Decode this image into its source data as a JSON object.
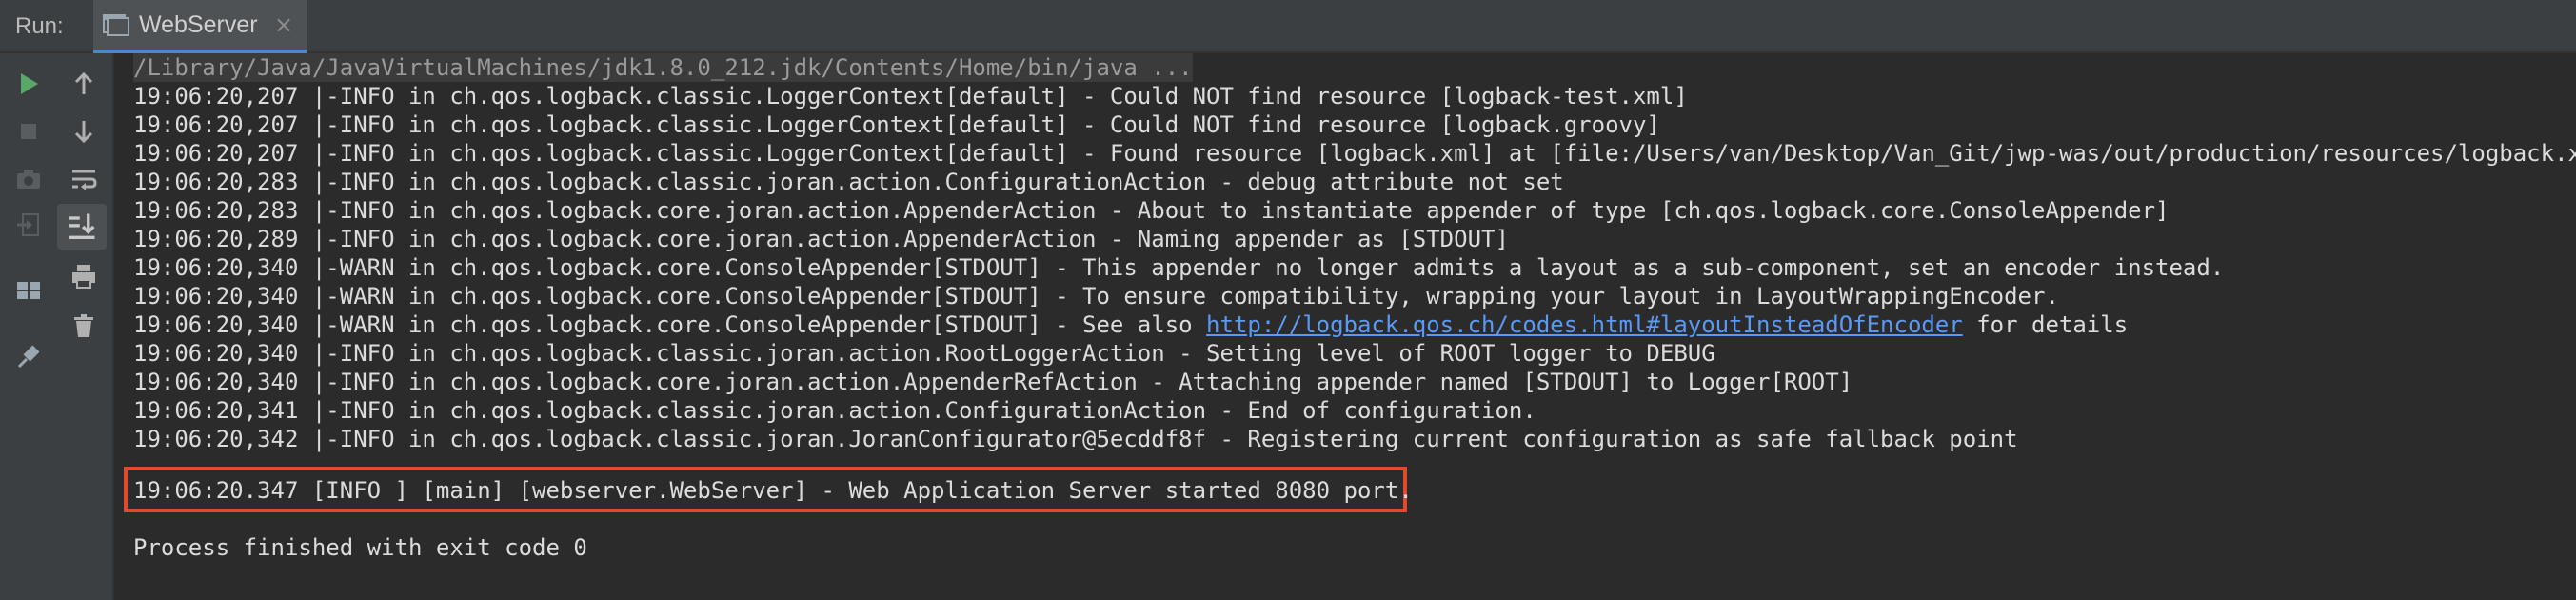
{
  "run_panel": {
    "label": "Run:",
    "tab": {
      "title": "WebServer",
      "close": "×"
    }
  },
  "toolbar": {
    "buttons": [
      {
        "name": "rerun-icon",
        "color": "#59a869"
      },
      {
        "name": "stop-icon"
      },
      {
        "name": "camera-icon"
      },
      {
        "name": "import-icon"
      },
      {
        "name": "layout-icon"
      },
      {
        "name": "pin-icon"
      },
      {
        "name": "up-arrow-icon"
      },
      {
        "name": "down-arrow-icon"
      },
      {
        "name": "soft-wrap-icon"
      },
      {
        "name": "scroll-to-end-icon"
      },
      {
        "name": "print-icon"
      },
      {
        "name": "trash-icon"
      }
    ]
  },
  "console": {
    "command": "/Library/Java/JavaVirtualMachines/jdk1.8.0_212.jdk/Contents/Home/bin/java ...",
    "lines": [
      "19:06:20,207 |-INFO in ch.qos.logback.classic.LoggerContext[default] - Could NOT find resource [logback-test.xml]",
      "19:06:20,207 |-INFO in ch.qos.logback.classic.LoggerContext[default] - Could NOT find resource [logback.groovy]",
      "19:06:20,207 |-INFO in ch.qos.logback.classic.LoggerContext[default] - Found resource [logback.xml] at [file:/Users/van/Desktop/Van_Git/jwp-was/out/production/resources/logback.xml]",
      "19:06:20,283 |-INFO in ch.qos.logback.classic.joran.action.ConfigurationAction - debug attribute not set",
      "19:06:20,283 |-INFO in ch.qos.logback.core.joran.action.AppenderAction - About to instantiate appender of type [ch.qos.logback.core.ConsoleAppender]",
      "19:06:20,289 |-INFO in ch.qos.logback.core.joran.action.AppenderAction - Naming appender as [STDOUT]",
      "19:06:20,340 |-WARN in ch.qos.logback.core.ConsoleAppender[STDOUT] - This appender no longer admits a layout as a sub-component, set an encoder instead.",
      "19:06:20,340 |-WARN in ch.qos.logback.core.ConsoleAppender[STDOUT] - To ensure compatibility, wrapping your layout in LayoutWrappingEncoder."
    ],
    "warn_link_line": {
      "prefix": "19:06:20,340 |-WARN in ch.qos.logback.core.ConsoleAppender[STDOUT] - See also ",
      "link": "http://logback.qos.ch/codes.html#layoutInsteadOfEncoder",
      "suffix": " for details"
    },
    "lines_after": [
      "19:06:20,340 |-INFO in ch.qos.logback.classic.joran.action.RootLoggerAction - Setting level of ROOT logger to DEBUG",
      "19:06:20,340 |-INFO in ch.qos.logback.core.joran.action.AppenderRefAction - Attaching appender named [STDOUT] to Logger[ROOT]",
      "19:06:20,341 |-INFO in ch.qos.logback.classic.joran.action.ConfigurationAction - End of configuration.",
      "19:06:20,342 |-INFO in ch.qos.logback.classic.joran.JoranConfigurator@5ecddf8f - Registering current configuration as safe fallback point"
    ],
    "highlighted_line": "19:06:20.347 [INFO ] [main] [webserver.WebServer] - Web Application Server started 8080 port.",
    "exit_line": "Process finished with exit code 0"
  },
  "colors": {
    "highlight_border": "#e14a2e",
    "link": "#5a9af5",
    "run_green": "#59a869"
  }
}
